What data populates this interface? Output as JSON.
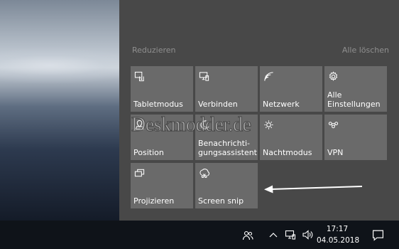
{
  "panel": {
    "collapse_label": "Reduzieren",
    "clear_all_label": "Alle löschen"
  },
  "tiles": [
    {
      "label": "Tablet­modus",
      "icon": "tablet-mode-icon"
    },
    {
      "label": "Verbinden",
      "icon": "connect-icon"
    },
    {
      "label": "Netzwerk",
      "icon": "network-icon"
    },
    {
      "label": "Alle\nEinstellungen",
      "icon": "settings-gear-icon"
    },
    {
      "label": "Position",
      "icon": "location-icon"
    },
    {
      "label": "Benachrichti-\ngungsassistent",
      "icon": "focus-assist-moon-icon"
    },
    {
      "label": "Nachtmodus",
      "icon": "night-light-icon"
    },
    {
      "label": "VPN",
      "icon": "vpn-icon"
    },
    {
      "label": "Projizieren",
      "icon": "project-icon"
    },
    {
      "label": "Screen snip",
      "icon": "screen-snip-icon"
    }
  ],
  "watermark": "Deskmodder.de",
  "taskbar": {
    "time": "17:17",
    "date": "04.05.2018"
  },
  "colors": {
    "panel_bg": "#484848",
    "tile_bg": "#6a6a6a",
    "taskbar_bg": "#0f1319",
    "annotation_arrow": "#ffffff"
  }
}
